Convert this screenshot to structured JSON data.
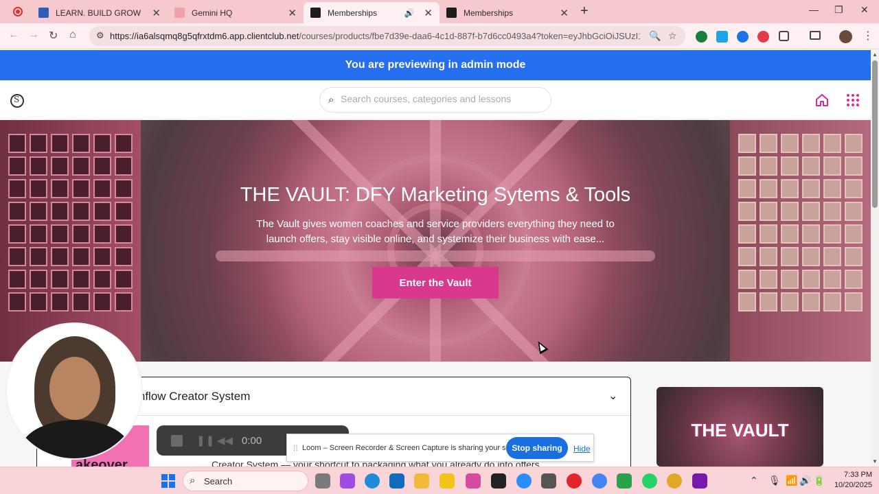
{
  "browser": {
    "tabs": [
      {
        "title": "LEARN. BUILD GROW",
        "active": false
      },
      {
        "title": "Gemini HQ",
        "active": false
      },
      {
        "title": "Memberships",
        "active": true
      },
      {
        "title": "Memberships",
        "active": false
      }
    ],
    "url_host": "https://ia6alsqmq8g5qfrxtdm6.app.clientclub.net",
    "url_path": "/courses/products/fbe7d39e-daa6-4c1d-887f-b7d6cc0493a4?token=eyJhbGciOiJSUzI1NiIsInR5cCI6I..."
  },
  "admin_banner": "You are previewing in admin mode",
  "header": {
    "search_placeholder": "Search courses, categories and lessons"
  },
  "hero": {
    "title": "THE VAULT: DFY Marketing Sytems & Tools",
    "subtitle": "The Vault gives women coaches and service providers everything they need to launch offers, stay visible online, and systemize their business with ease...",
    "cta": "Enter the Vault"
  },
  "section": {
    "title": "he Cashflow Creator System",
    "thumb_text": "er\nakeover\nGuide",
    "description": "Creator System — your shortcut to packaging what you already do into offers"
  },
  "side_card_title": "THE VAULT",
  "loom": {
    "time": "0:00",
    "message": "Loom – Screen Recorder & Screen Capture is sharing your screen.",
    "stop_label": "Stop sharing",
    "hide_label": "Hide"
  },
  "taskbar": {
    "search_label": "Search",
    "time": "7:33 PM",
    "date": "10/20/2025"
  },
  "colors": {
    "admin_bar": "#256ef0",
    "cta": "#d9388c",
    "accent_icons": "#d9279c",
    "stop_sharing": "#1a6fe0"
  }
}
